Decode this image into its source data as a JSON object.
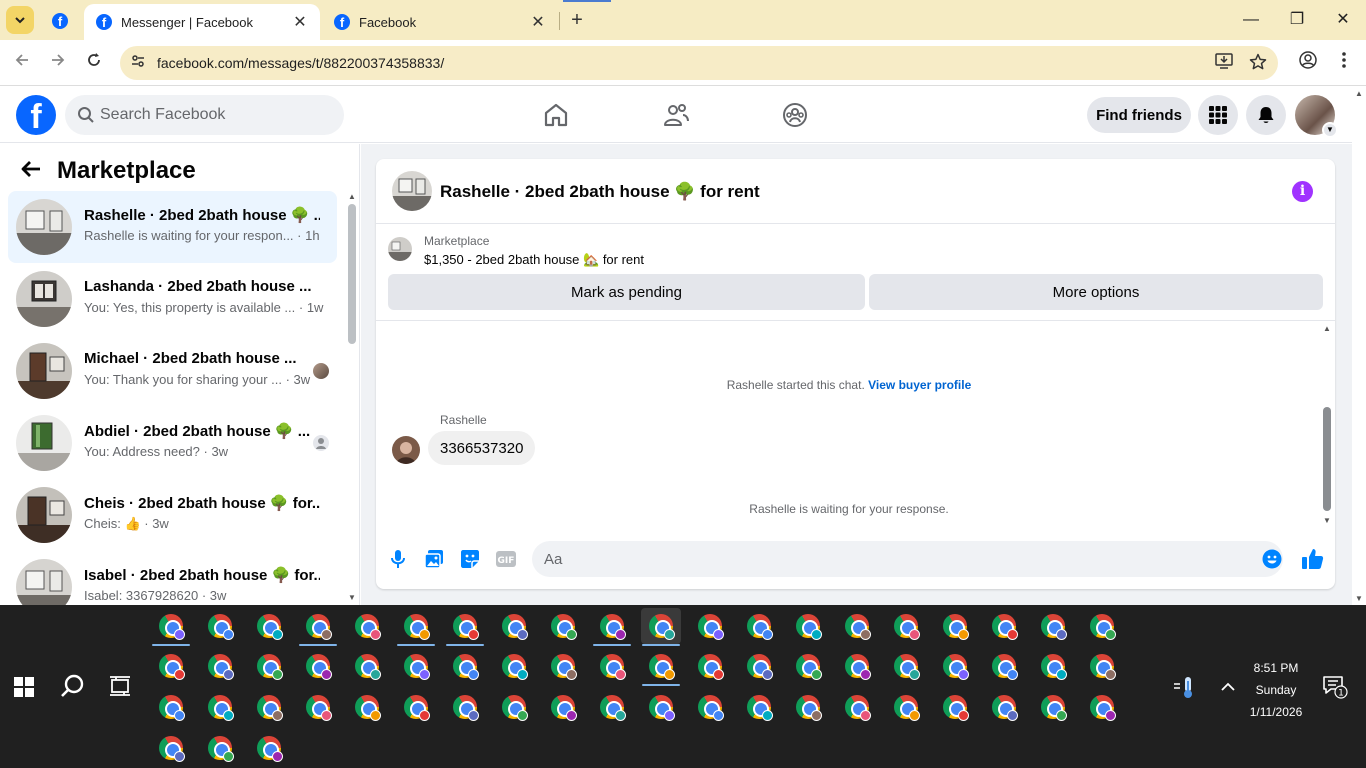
{
  "browser": {
    "tabs": [
      {
        "title": "Messenger | Facebook",
        "active": true
      },
      {
        "title": "Facebook",
        "active": false
      }
    ],
    "close_glyph": "✕",
    "new_tab_glyph": "+",
    "url": "facebook.com/messages/t/882200374358833/",
    "window_controls": {
      "minimize": "—",
      "maximize": "❐",
      "close": "✕"
    }
  },
  "fb_header": {
    "logo_letter": "f",
    "search_placeholder": "Search Facebook",
    "find_friends_label": "Find friends"
  },
  "left_panel": {
    "title": "Marketplace",
    "conversations": [
      {
        "name": "Rashelle · 2bed 2bath house 🌳 ...",
        "preview": "Rashelle is waiting for your respon... · 1h",
        "selected": true
      },
      {
        "name": "Lashanda · 2bed 2bath house ...",
        "preview": "You: Yes, this property is available ... · 1w",
        "selected": false
      },
      {
        "name": "Michael · 2bed 2bath house ...",
        "preview": "You: Thank you for sharing your ... · 3w",
        "selected": false
      },
      {
        "name": "Abdiel · 2bed 2bath house 🌳 ...",
        "preview": "You: Address need? · 3w",
        "selected": false
      },
      {
        "name": "Cheis · 2bed 2bath house 🌳 for...",
        "preview": "Cheis: 👍 · 3w",
        "selected": false
      },
      {
        "name": "Isabel · 2bed 2bath house 🌳 for...",
        "preview": "Isabel: 3367928620 · 3w",
        "selected": false
      }
    ]
  },
  "chat": {
    "title": "Rashelle · 2bed 2bath house 🌳 for rent",
    "info_glyph": "i",
    "listing_label": "Marketplace",
    "listing_price": "$1,350 - 2bed 2bath house 🏡 for rent",
    "mark_pending_label": "Mark as pending",
    "more_options_label": "More options",
    "started_text": "Rashelle started this chat.",
    "view_profile_link": "View buyer profile",
    "sender_name": "Rashelle",
    "message_text": "3366537320",
    "waiting_text": "Rashelle is waiting for your response.",
    "input_placeholder": "Aa"
  },
  "taskbar": {
    "time": "8:51 PM",
    "day": "Sunday",
    "date": "1/11/2026",
    "notification_count": "1"
  },
  "colors": {
    "fb_blue": "#0866ff",
    "messenger_blue": "#0084ff",
    "info_purple": "#a033ff",
    "selected_bg": "#ebf5ff",
    "tabstrip_bg": "#f6ecc4",
    "taskbar_bg": "#202020"
  }
}
